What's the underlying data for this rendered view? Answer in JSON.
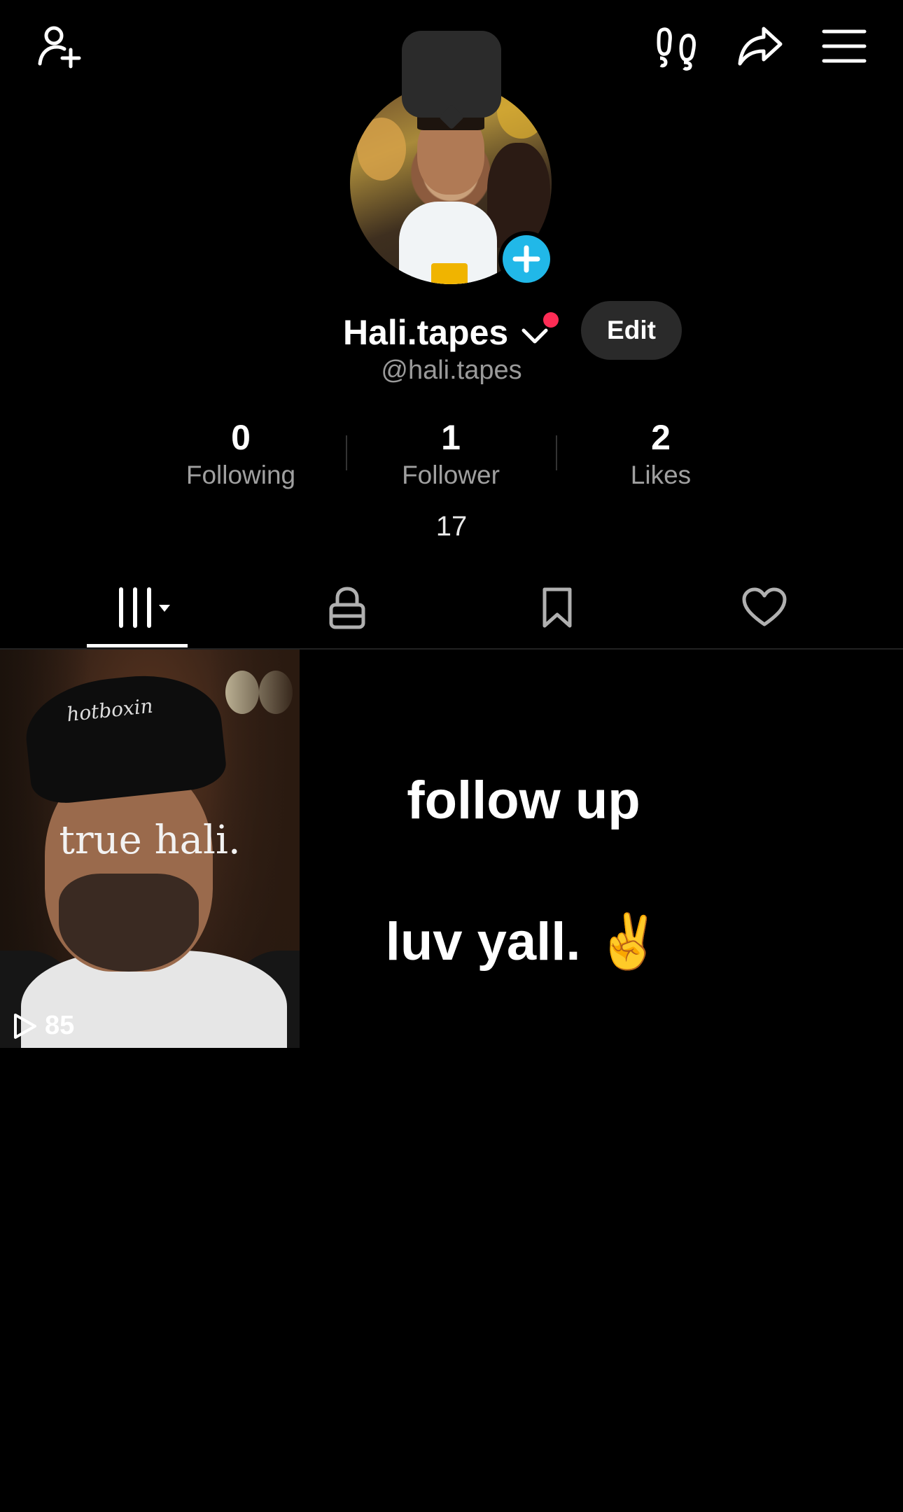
{
  "header": {
    "icons": [
      "add-friend-icon",
      "footprints-icon",
      "share-icon",
      "menu-icon"
    ]
  },
  "profile": {
    "username": "Hali.tapes",
    "handle": "@hali.tapes",
    "edit_label": "Edit",
    "bio": "17"
  },
  "stats": [
    {
      "value": "0",
      "label": "Following"
    },
    {
      "value": "1",
      "label": "Follower"
    },
    {
      "value": "2",
      "label": "Likes"
    }
  ],
  "tabs": [
    "videos-grid-icon",
    "lock-icon",
    "bookmark-icon",
    "heart-icon"
  ],
  "videos": [
    {
      "caption": "true hali.",
      "brand": "hotboxin",
      "plays": "85"
    }
  ],
  "text_post": {
    "line1": "follow up",
    "line2": "luv yall. ✌️"
  },
  "colors": {
    "accent": "#fe2c55",
    "avatar_plus": "#21b8e8"
  }
}
